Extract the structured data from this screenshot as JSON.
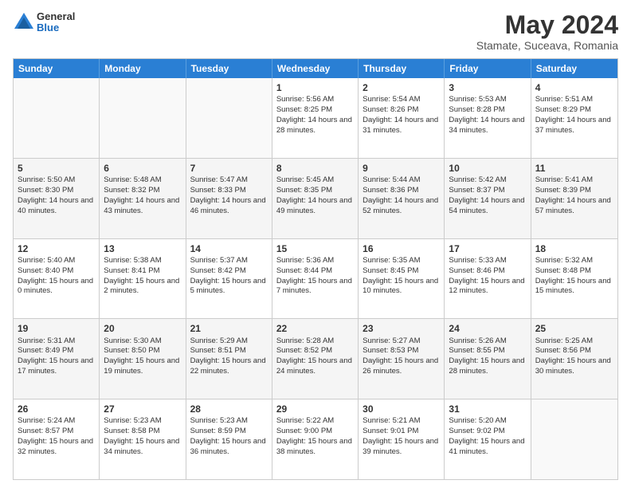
{
  "header": {
    "logo_general": "General",
    "logo_blue": "Blue",
    "main_title": "May 2024",
    "subtitle": "Stamate, Suceava, Romania"
  },
  "days_of_week": [
    "Sunday",
    "Monday",
    "Tuesday",
    "Wednesday",
    "Thursday",
    "Friday",
    "Saturday"
  ],
  "weeks": [
    [
      {
        "day": "",
        "sunrise": "",
        "sunset": "",
        "daylight": ""
      },
      {
        "day": "",
        "sunrise": "",
        "sunset": "",
        "daylight": ""
      },
      {
        "day": "",
        "sunrise": "",
        "sunset": "",
        "daylight": ""
      },
      {
        "day": "1",
        "sunrise": "Sunrise: 5:56 AM",
        "sunset": "Sunset: 8:25 PM",
        "daylight": "Daylight: 14 hours and 28 minutes."
      },
      {
        "day": "2",
        "sunrise": "Sunrise: 5:54 AM",
        "sunset": "Sunset: 8:26 PM",
        "daylight": "Daylight: 14 hours and 31 minutes."
      },
      {
        "day": "3",
        "sunrise": "Sunrise: 5:53 AM",
        "sunset": "Sunset: 8:28 PM",
        "daylight": "Daylight: 14 hours and 34 minutes."
      },
      {
        "day": "4",
        "sunrise": "Sunrise: 5:51 AM",
        "sunset": "Sunset: 8:29 PM",
        "daylight": "Daylight: 14 hours and 37 minutes."
      }
    ],
    [
      {
        "day": "5",
        "sunrise": "Sunrise: 5:50 AM",
        "sunset": "Sunset: 8:30 PM",
        "daylight": "Daylight: 14 hours and 40 minutes."
      },
      {
        "day": "6",
        "sunrise": "Sunrise: 5:48 AM",
        "sunset": "Sunset: 8:32 PM",
        "daylight": "Daylight: 14 hours and 43 minutes."
      },
      {
        "day": "7",
        "sunrise": "Sunrise: 5:47 AM",
        "sunset": "Sunset: 8:33 PM",
        "daylight": "Daylight: 14 hours and 46 minutes."
      },
      {
        "day": "8",
        "sunrise": "Sunrise: 5:45 AM",
        "sunset": "Sunset: 8:35 PM",
        "daylight": "Daylight: 14 hours and 49 minutes."
      },
      {
        "day": "9",
        "sunrise": "Sunrise: 5:44 AM",
        "sunset": "Sunset: 8:36 PM",
        "daylight": "Daylight: 14 hours and 52 minutes."
      },
      {
        "day": "10",
        "sunrise": "Sunrise: 5:42 AM",
        "sunset": "Sunset: 8:37 PM",
        "daylight": "Daylight: 14 hours and 54 minutes."
      },
      {
        "day": "11",
        "sunrise": "Sunrise: 5:41 AM",
        "sunset": "Sunset: 8:39 PM",
        "daylight": "Daylight: 14 hours and 57 minutes."
      }
    ],
    [
      {
        "day": "12",
        "sunrise": "Sunrise: 5:40 AM",
        "sunset": "Sunset: 8:40 PM",
        "daylight": "Daylight: 15 hours and 0 minutes."
      },
      {
        "day": "13",
        "sunrise": "Sunrise: 5:38 AM",
        "sunset": "Sunset: 8:41 PM",
        "daylight": "Daylight: 15 hours and 2 minutes."
      },
      {
        "day": "14",
        "sunrise": "Sunrise: 5:37 AM",
        "sunset": "Sunset: 8:42 PM",
        "daylight": "Daylight: 15 hours and 5 minutes."
      },
      {
        "day": "15",
        "sunrise": "Sunrise: 5:36 AM",
        "sunset": "Sunset: 8:44 PM",
        "daylight": "Daylight: 15 hours and 7 minutes."
      },
      {
        "day": "16",
        "sunrise": "Sunrise: 5:35 AM",
        "sunset": "Sunset: 8:45 PM",
        "daylight": "Daylight: 15 hours and 10 minutes."
      },
      {
        "day": "17",
        "sunrise": "Sunrise: 5:33 AM",
        "sunset": "Sunset: 8:46 PM",
        "daylight": "Daylight: 15 hours and 12 minutes."
      },
      {
        "day": "18",
        "sunrise": "Sunrise: 5:32 AM",
        "sunset": "Sunset: 8:48 PM",
        "daylight": "Daylight: 15 hours and 15 minutes."
      }
    ],
    [
      {
        "day": "19",
        "sunrise": "Sunrise: 5:31 AM",
        "sunset": "Sunset: 8:49 PM",
        "daylight": "Daylight: 15 hours and 17 minutes."
      },
      {
        "day": "20",
        "sunrise": "Sunrise: 5:30 AM",
        "sunset": "Sunset: 8:50 PM",
        "daylight": "Daylight: 15 hours and 19 minutes."
      },
      {
        "day": "21",
        "sunrise": "Sunrise: 5:29 AM",
        "sunset": "Sunset: 8:51 PM",
        "daylight": "Daylight: 15 hours and 22 minutes."
      },
      {
        "day": "22",
        "sunrise": "Sunrise: 5:28 AM",
        "sunset": "Sunset: 8:52 PM",
        "daylight": "Daylight: 15 hours and 24 minutes."
      },
      {
        "day": "23",
        "sunrise": "Sunrise: 5:27 AM",
        "sunset": "Sunset: 8:53 PM",
        "daylight": "Daylight: 15 hours and 26 minutes."
      },
      {
        "day": "24",
        "sunrise": "Sunrise: 5:26 AM",
        "sunset": "Sunset: 8:55 PM",
        "daylight": "Daylight: 15 hours and 28 minutes."
      },
      {
        "day": "25",
        "sunrise": "Sunrise: 5:25 AM",
        "sunset": "Sunset: 8:56 PM",
        "daylight": "Daylight: 15 hours and 30 minutes."
      }
    ],
    [
      {
        "day": "26",
        "sunrise": "Sunrise: 5:24 AM",
        "sunset": "Sunset: 8:57 PM",
        "daylight": "Daylight: 15 hours and 32 minutes."
      },
      {
        "day": "27",
        "sunrise": "Sunrise: 5:23 AM",
        "sunset": "Sunset: 8:58 PM",
        "daylight": "Daylight: 15 hours and 34 minutes."
      },
      {
        "day": "28",
        "sunrise": "Sunrise: 5:23 AM",
        "sunset": "Sunset: 8:59 PM",
        "daylight": "Daylight: 15 hours and 36 minutes."
      },
      {
        "day": "29",
        "sunrise": "Sunrise: 5:22 AM",
        "sunset": "Sunset: 9:00 PM",
        "daylight": "Daylight: 15 hours and 38 minutes."
      },
      {
        "day": "30",
        "sunrise": "Sunrise: 5:21 AM",
        "sunset": "Sunset: 9:01 PM",
        "daylight": "Daylight: 15 hours and 39 minutes."
      },
      {
        "day": "31",
        "sunrise": "Sunrise: 5:20 AM",
        "sunset": "Sunset: 9:02 PM",
        "daylight": "Daylight: 15 hours and 41 minutes."
      },
      {
        "day": "",
        "sunrise": "",
        "sunset": "",
        "daylight": ""
      }
    ]
  ]
}
